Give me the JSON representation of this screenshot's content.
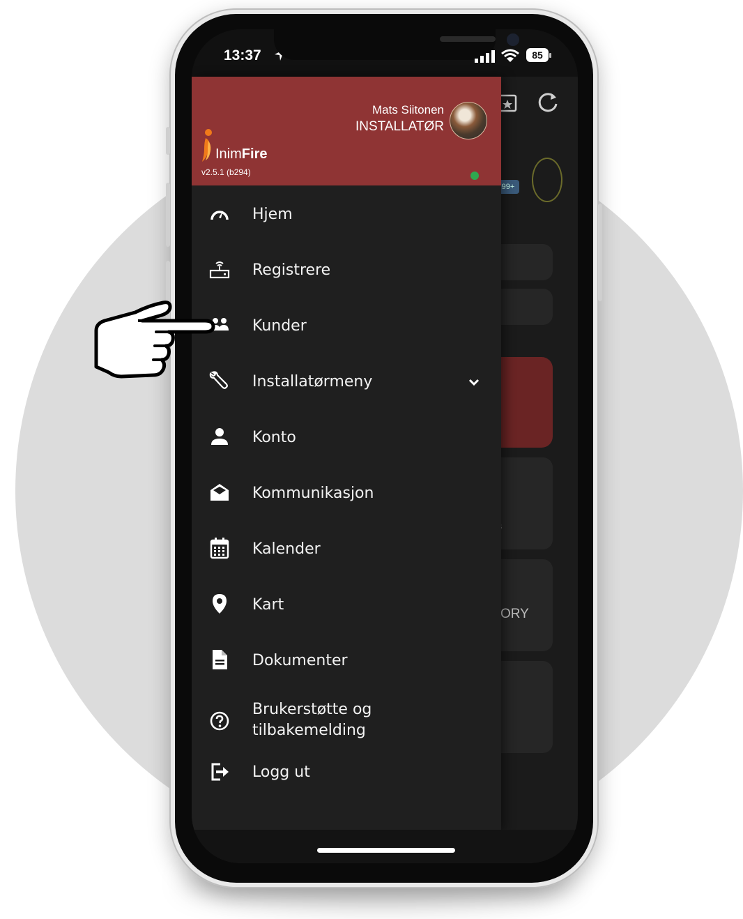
{
  "status_bar": {
    "time": "13:37",
    "battery": "85"
  },
  "drawer": {
    "user": {
      "name": "Mats Siitonen",
      "role": "INSTALLATØR"
    },
    "brand": {
      "prefix": "Inim",
      "suffix": "Fire",
      "version": "v2.5.1 (b294)"
    },
    "menu_items": [
      {
        "label": "Hjem",
        "icon": "speedometer-icon"
      },
      {
        "label": "Registrere",
        "icon": "router-icon"
      },
      {
        "label": "Kunder",
        "icon": "users-icon"
      },
      {
        "label": "Installatørmeny",
        "icon": "wrench-icon",
        "expandable": true
      },
      {
        "label": "Konto",
        "icon": "person-icon"
      },
      {
        "label": "Kommunikasjon",
        "icon": "mail-open-icon"
      },
      {
        "label": "Kalender",
        "icon": "calendar-icon"
      },
      {
        "label": "Kart",
        "icon": "map-pin-icon"
      },
      {
        "label": "Dokumenter",
        "icon": "document-icon"
      },
      {
        "label": "Brukerstøtte og tilbakemelding",
        "label_line1": "Brukerstøtte og",
        "label_line2": "tilbakemelding",
        "icon": "help-circle-icon"
      },
      {
        "label": "Logg ut",
        "icon": "logout-icon"
      }
    ]
  },
  "background_app": {
    "badge": "99+",
    "partial_text_1": "s",
    "partial_text_2": "ORY"
  },
  "colors": {
    "drawer_header": "#8f3434",
    "drawer_bg": "#1f1f1f",
    "online_status": "#2fa84f",
    "background_circle": "#dcdcdc"
  }
}
